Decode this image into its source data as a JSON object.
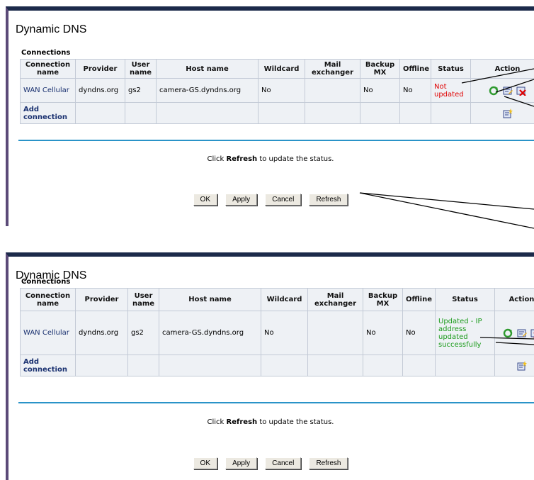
{
  "screens": [
    {
      "title": "Dynamic DNS",
      "section": "Connections",
      "columns": [
        "Connection name",
        "Provider",
        "User name",
        "Host name",
        "Wildcard",
        "Mail exchanger",
        "Backup MX",
        "Offline",
        "Status",
        "Action"
      ],
      "rows": [
        {
          "connection": "WAN Cellular",
          "provider": "dyndns.org",
          "user": "gs2",
          "host": "camera-GS.dyndns.org",
          "wildcard": "No",
          "mail": "",
          "backup": "No",
          "offline": "No",
          "status": "Not updated"
        }
      ],
      "add_connection": "Add connection",
      "hint_pre": "Click ",
      "hint_bold": "Refresh",
      "hint_post": " to update the status.",
      "buttons": {
        "ok": "OK",
        "apply": "Apply",
        "cancel": "Cancel",
        "refresh": "Refresh"
      }
    },
    {
      "title": "Dynamic DNS",
      "section": "Connections",
      "columns": [
        "Connection name",
        "Provider",
        "User name",
        "Host name",
        "Wildcard",
        "Mail exchanger",
        "Backup MX",
        "Offline",
        "Status",
        "Action"
      ],
      "rows": [
        {
          "connection": "WAN Cellular",
          "provider": "dyndns.org",
          "user": "gs2",
          "host": "camera-GS.dyndns.org",
          "wildcard": "No",
          "mail": "",
          "backup": "No",
          "offline": "No",
          "status": "Updated - IP address updated successfully"
        }
      ],
      "add_connection": "Add connection",
      "hint_pre": "Click ",
      "hint_bold": "Refresh",
      "hint_post": " to update the status.",
      "buttons": {
        "ok": "OK",
        "apply": "Apply",
        "cancel": "Cancel",
        "refresh": "Refresh"
      }
    }
  ],
  "colors": {
    "header_bar": "#1c2a4a",
    "left_bar": "#5b4a78",
    "divider": "#2a93c8",
    "status_bad": "#e00000",
    "status_good": "#1b9b1b"
  },
  "icons": [
    "refresh-icon",
    "edit-icon",
    "delete-icon",
    "add-connection-icon"
  ]
}
